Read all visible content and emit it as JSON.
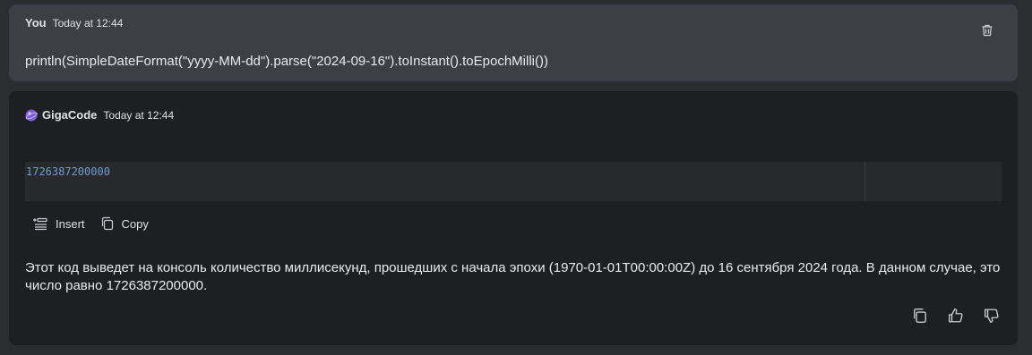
{
  "user_message": {
    "author": "You",
    "time": "Today at 12:44",
    "text": "println(SimpleDateFormat(\"yyyy-MM-dd\").parse(\"2024-09-16\").toInstant().toEpochMilli())",
    "delete_icon": "trash-icon"
  },
  "bot_message": {
    "author": "GigaCode",
    "time": "Today at 12:44",
    "logo_icon": "gigacode-logo-icon",
    "code": "1726387200000",
    "insert_label": "Insert",
    "copy_label": "Copy",
    "answer": "Этот код выведет на консоль количество миллисекунд, прошедших с начала эпохи (1970-01-01T00:00:00Z) до 16 сентября 2024 года. В данном случае, это число равно 1726387200000.",
    "feedback_icons": [
      "copy-icon",
      "thumbs-up-icon",
      "thumbs-down-icon"
    ]
  },
  "colors": {
    "background": "#2b2d30",
    "user_bubble": "#3c3f45",
    "bot_bubble": "#1e1f22",
    "code_text": "#6f9cd1"
  }
}
